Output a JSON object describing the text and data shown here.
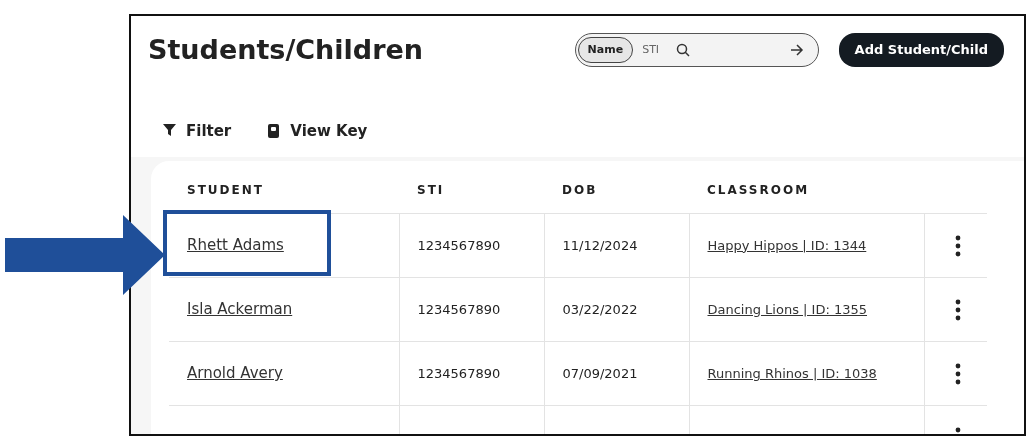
{
  "page": {
    "title": "Students/Children"
  },
  "search": {
    "modes": [
      {
        "label": "Name",
        "selected": true
      },
      {
        "label": "STI",
        "selected": false
      }
    ]
  },
  "add_button": "Add Student/Child",
  "toolbar": [
    {
      "label": "Filter",
      "kind": "filter"
    },
    {
      "label": "View Key",
      "kind": "key"
    }
  ],
  "table": {
    "columns": [
      "STUDENT",
      "STI",
      "DOB",
      "CLASSROOM"
    ],
    "rows": [
      {
        "student": "Rhett Adams",
        "sti": "1234567890",
        "dob": "11/12/2024",
        "classroom": "Happy Hippos | ID: 1344",
        "highlighted": true
      },
      {
        "student": "Isla Ackerman",
        "sti": "1234567890",
        "dob": "03/22/2022",
        "classroom": "Dancing Lions | ID: 1355",
        "highlighted": false
      },
      {
        "student": "Arnold Avery",
        "sti": "1234567890",
        "dob": "07/09/2021",
        "classroom": "Running Rhinos | ID: 1038",
        "highlighted": false
      }
    ]
  }
}
